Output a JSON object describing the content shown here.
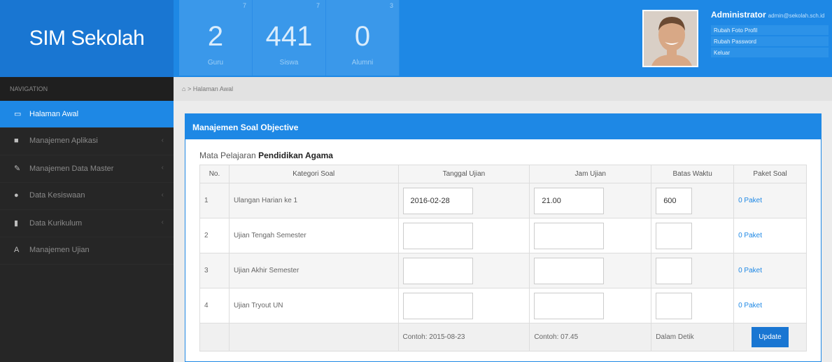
{
  "brand": "SIM Sekolah",
  "stats": [
    {
      "mini": "7",
      "number": "2",
      "label": "Guru"
    },
    {
      "mini": "7",
      "number": "441",
      "label": "Siswa"
    },
    {
      "mini": "3",
      "number": "0",
      "label": "Alumni"
    }
  ],
  "user": {
    "name": "Administrator",
    "email": "admin@sekolah.sch.id",
    "menu": [
      "Rubah Foto Profil",
      "Rubah Password",
      "Keluar"
    ]
  },
  "sidebar": {
    "heading": "NAVIGATION",
    "items": [
      {
        "label": "Halaman Awal",
        "icon": "monitor-icon",
        "glyph": "▭"
      },
      {
        "label": "Manajemen Aplikasi",
        "icon": "briefcase-icon",
        "glyph": "■"
      },
      {
        "label": "Manajemen Data Master",
        "icon": "pencil-icon",
        "glyph": "✎"
      },
      {
        "label": "Data Kesiswaan",
        "icon": "users-icon",
        "glyph": "●"
      },
      {
        "label": "Data Kurikulum",
        "icon": "book-icon",
        "glyph": "▮"
      },
      {
        "label": "Manajemen Ujian",
        "icon": "font-icon",
        "glyph": "A"
      }
    ]
  },
  "breadcrumb": {
    "home_glyph": "⌂",
    "separator": ">",
    "current": "Halaman Awal"
  },
  "panel": {
    "title": "Manajemen Soal Objective",
    "mapel_label": "Mata Pelajaran",
    "mapel_value": "Pendidikan Agama"
  },
  "table": {
    "headers": [
      "No.",
      "Kategori Soal",
      "Tanggal Ujian",
      "Jam Ujian",
      "Batas Waktu",
      "Paket Soal"
    ],
    "rows": [
      {
        "no": "1",
        "kategori": "Ulangan Harian ke 1",
        "tanggal": "2016-02-28",
        "jam": "21.00",
        "batas": "600",
        "paket": "0 Paket"
      },
      {
        "no": "2",
        "kategori": "Ujian Tengah Semester",
        "tanggal": "",
        "jam": "",
        "batas": "",
        "paket": "0 Paket"
      },
      {
        "no": "3",
        "kategori": "Ujian Akhir Semester",
        "tanggal": "",
        "jam": "",
        "batas": "",
        "paket": "0 Paket"
      },
      {
        "no": "4",
        "kategori": "Ujian Tryout UN",
        "tanggal": "",
        "jam": "",
        "batas": "",
        "paket": "0 Paket"
      }
    ],
    "hint": {
      "tanggal": "Contoh: 2015-08-23",
      "jam": "Contoh: 07.45",
      "batas": "Dalam Detik"
    },
    "update_label": "Update"
  }
}
